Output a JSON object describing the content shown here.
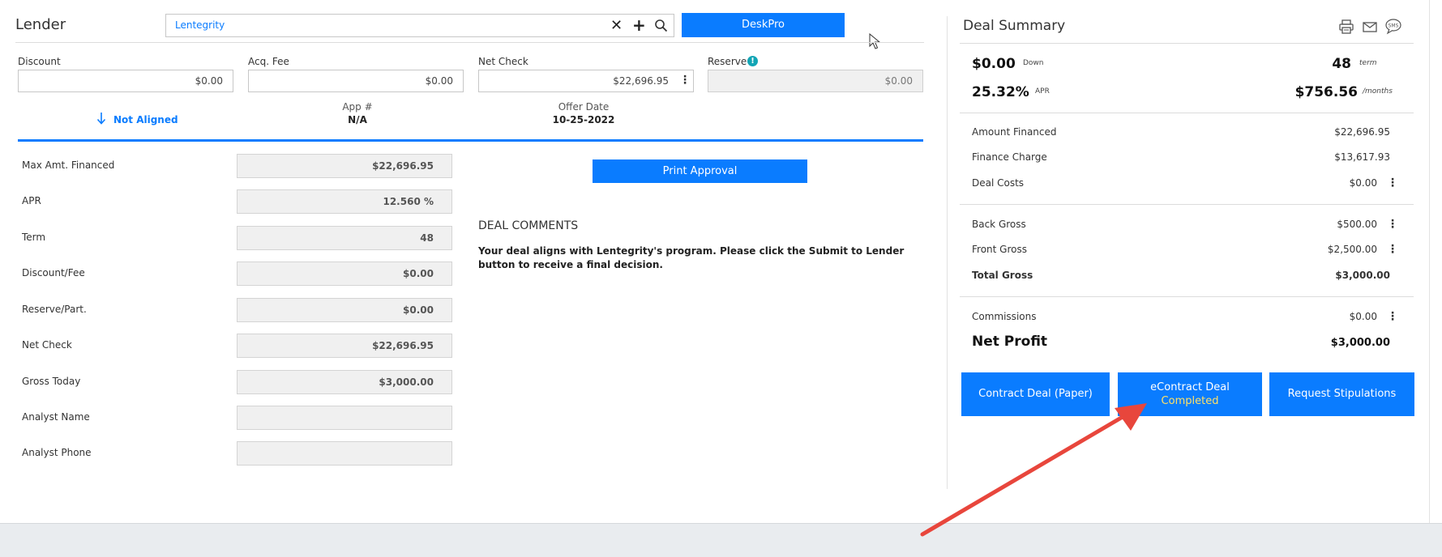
{
  "lender": {
    "title": "Lender",
    "search_value": "Lentegrity",
    "deskpro_label": "DeskPro"
  },
  "fields": {
    "discount_label": "Discount",
    "discount_value": "$0.00",
    "acq_label": "Acq. Fee",
    "acq_value": "$0.00",
    "netcheck_label": "Net Check",
    "netcheck_value": "$22,696.95",
    "reserve_label": "Reserve",
    "reserve_value": "$0.00"
  },
  "status": {
    "aligned": "Not Aligned",
    "app_label": "App #",
    "app_value": "N/A",
    "offer_label": "Offer Date",
    "offer_value": "10-25-2022"
  },
  "approval": [
    {
      "label": "Max Amt. Financed",
      "value": "$22,696.95"
    },
    {
      "label": "APR",
      "value": "12.560 %"
    },
    {
      "label": "Term",
      "value": "48"
    },
    {
      "label": "Discount/Fee",
      "value": "$0.00"
    },
    {
      "label": "Reserve/Part.",
      "value": "$0.00"
    },
    {
      "label": "Net Check",
      "value": "$22,696.95"
    },
    {
      "label": "Gross Today",
      "value": "$3,000.00"
    },
    {
      "label": "Analyst Name",
      "value": ""
    },
    {
      "label": "Analyst Phone",
      "value": ""
    }
  ],
  "print_approval": "Print Approval",
  "comments": {
    "title": "DEAL COMMENTS",
    "text": "Your deal aligns with Lentegrity's program. Please click the Submit to Lender button to receive a final decision."
  },
  "summary": {
    "title": "Deal Summary",
    "down_value": "$0.00",
    "down_unit": "Down",
    "term_value": "48",
    "term_unit": "term",
    "apr_value": "25.32%",
    "apr_unit": "APR",
    "payment_value": "$756.56",
    "payment_unit": "/months",
    "amount_financed_label": "Amount Financed",
    "amount_financed_value": "$22,696.95",
    "finance_charge_label": "Finance Charge",
    "finance_charge_value": "$13,617.93",
    "deal_costs_label": "Deal Costs",
    "deal_costs_value": "$0.00",
    "back_gross_label": "Back Gross",
    "back_gross_value": "$500.00",
    "front_gross_label": "Front Gross",
    "front_gross_value": "$2,500.00",
    "total_gross_label": "Total Gross",
    "total_gross_value": "$3,000.00",
    "commissions_label": "Commissions",
    "commissions_value": "$0.00",
    "net_profit_label": "Net Profit",
    "net_profit_value": "$3,000.00"
  },
  "actions": {
    "contract_paper": "Contract Deal (Paper)",
    "econtract_line1": "eContract Deal",
    "econtract_line2": "Completed",
    "request_stips": "Request Stipulations"
  },
  "icons": {
    "print": "printer-icon",
    "email": "envelope-icon",
    "sms": "sms-icon",
    "info": "info-icon"
  },
  "colors": {
    "accent": "#0a7cff",
    "completed": "#ffe066",
    "annotation_arrow": "#e8463c"
  }
}
